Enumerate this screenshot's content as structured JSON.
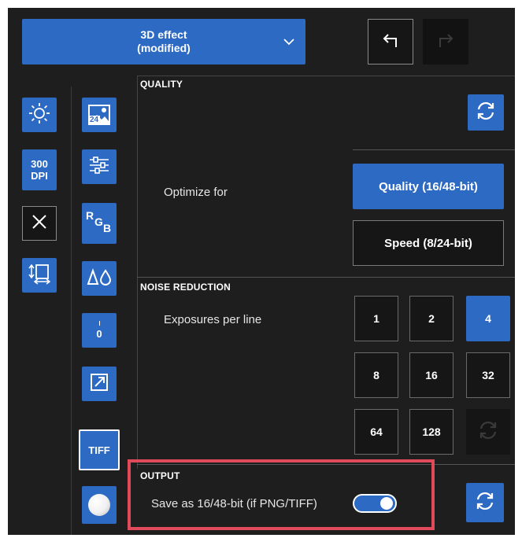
{
  "preset": {
    "line1": "3D effect",
    "line2": "(modified)"
  },
  "toolbar": {
    "undo_icon": "undo-icon",
    "redo_icon": "redo-icon"
  },
  "left_tools": {
    "col1": [
      {
        "name": "brightness-icon"
      },
      {
        "name": "dpi-button",
        "line1": "300",
        "line2": "DPI"
      },
      {
        "name": "close-icon"
      },
      {
        "name": "resize-icon"
      }
    ],
    "col2": [
      {
        "name": "image-24-icon",
        "badge": "24"
      },
      {
        "name": "sliders-icon"
      },
      {
        "name": "rgb-button",
        "r": "R",
        "g": "G",
        "b": "B"
      },
      {
        "name": "levels-icon"
      },
      {
        "name": "zero-button",
        "value": "0"
      },
      {
        "name": "crop-expand-icon"
      },
      {
        "name": "tiff-button",
        "label": "TIFF"
      },
      {
        "name": "white-ball-icon"
      }
    ]
  },
  "quality": {
    "title": "QUALITY",
    "optimize_label": "Optimize for",
    "options": [
      "Quality (16/48-bit)",
      "Speed (8/24-bit)"
    ],
    "selected": "Quality (16/48-bit)"
  },
  "noise_reduction": {
    "title": "NOISE REDUCTION",
    "exposures_label": "Exposures per line",
    "values": [
      "1",
      "2",
      "4",
      "8",
      "16",
      "32",
      "64",
      "128"
    ],
    "selected": "4"
  },
  "output": {
    "title": "OUTPUT",
    "save_label": "Save as 16/48-bit (if PNG/TIFF)",
    "toggle_on": true
  },
  "colors": {
    "accent": "#2d6ac4",
    "highlight": "#e04a5a",
    "background": "#1e1e1e"
  }
}
